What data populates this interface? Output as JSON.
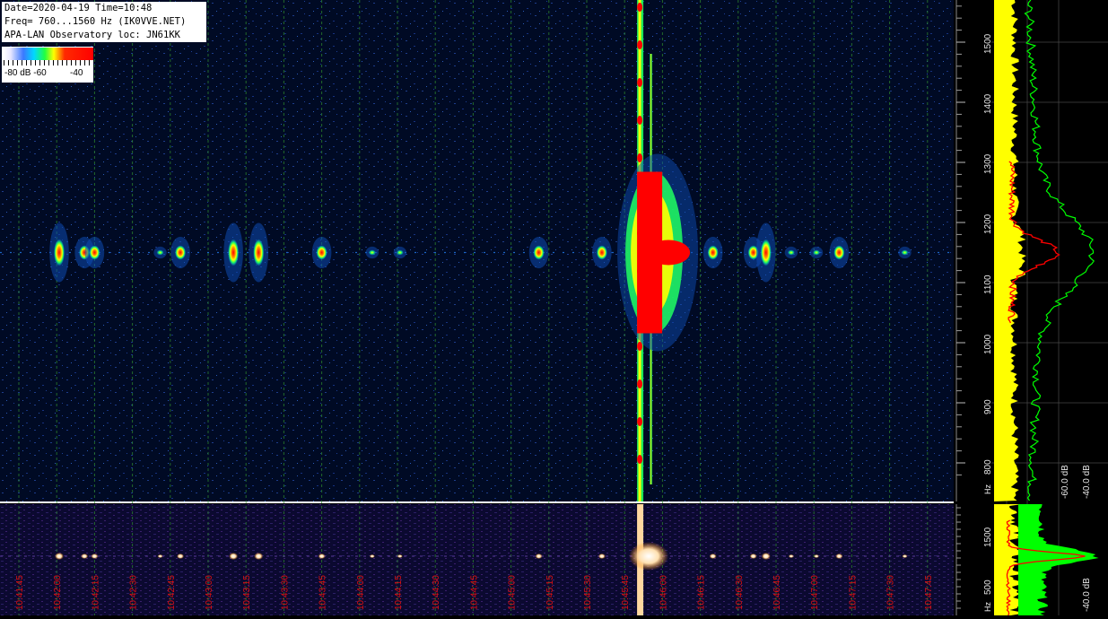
{
  "info": {
    "line1": "Date=2020-04-19 Time=10:48",
    "line2": "Freq= 760...1560 Hz (IK0VVE.NET)",
    "line3": "APA-LAN Observatory loc: JN61KK"
  },
  "colorbar": {
    "label_left": "-80 dB -60",
    "label_right": "-40",
    "colors": [
      "#ffffff",
      "#3a78ff",
      "#00d8ff",
      "#21ff40",
      "#ffff00",
      "#ff2a00",
      "#ff0000"
    ]
  },
  "chart_data": [
    {
      "type": "heatmap",
      "panel": "main-waterfall",
      "x_time_ticks": [
        "10:41:45",
        "10:42:00",
        "10:42:15",
        "10:42:30",
        "10:42:45",
        "10:43:00",
        "10:43:15",
        "10:43:30",
        "10:43:45",
        "10:44:00",
        "10:44:15",
        "10:44:30",
        "10:44:45",
        "10:45:00",
        "10:45:15",
        "10:45:30",
        "10:45:45",
        "10:46:00",
        "10:46:15",
        "10:46:30",
        "10:46:45",
        "10:47:00",
        "10:47:15",
        "10:47:30",
        "10:47:45"
      ],
      "y_freq_ticks": [
        1500,
        1400,
        1300,
        1200,
        1100,
        1000,
        900,
        800
      ],
      "y_unit": "Hz",
      "ylim": [
        760,
        1560
      ],
      "carrier_hz": 1150,
      "events": [
        {
          "time": "10:42:01",
          "strength": "strong"
        },
        {
          "time": "10:42:11",
          "strength": "medium"
        },
        {
          "time": "10:42:15",
          "strength": "medium"
        },
        {
          "time": "10:42:41",
          "strength": "weak"
        },
        {
          "time": "10:42:49",
          "strength": "medium"
        },
        {
          "time": "10:43:10",
          "strength": "strong"
        },
        {
          "time": "10:43:20",
          "strength": "strong"
        },
        {
          "time": "10:43:45",
          "strength": "medium"
        },
        {
          "time": "10:44:05",
          "strength": "weak"
        },
        {
          "time": "10:44:16",
          "strength": "weak"
        },
        {
          "time": "10:45:11",
          "strength": "medium"
        },
        {
          "time": "10:45:36",
          "strength": "medium"
        },
        {
          "time": "10:45:51",
          "strength": "very_strong"
        },
        {
          "time": "10:46:20",
          "strength": "medium"
        },
        {
          "time": "10:46:36",
          "strength": "medium"
        },
        {
          "time": "10:46:41",
          "strength": "strong"
        },
        {
          "time": "10:46:51",
          "strength": "weak"
        },
        {
          "time": "10:47:01",
          "strength": "weak"
        },
        {
          "time": "10:47:10",
          "strength": "medium"
        },
        {
          "time": "10:47:36",
          "strength": "weak"
        }
      ]
    },
    {
      "type": "heatmap",
      "panel": "lower-waterfall",
      "y_freq_ticks": [
        1500,
        500
      ],
      "y_unit": "Hz"
    },
    {
      "type": "line",
      "panel": "main-spectrum",
      "x_db_ticks": [
        "-60.0 dB",
        "-40.0 dB"
      ],
      "series_colors": [
        "#ffff00",
        "#ff0000",
        "#00ff00"
      ],
      "peak_hz": 1150
    },
    {
      "type": "line",
      "panel": "lower-spectrum",
      "x_db_ticks": [
        "-40.0 dB"
      ]
    }
  ],
  "labels": {
    "hz": "Hz"
  }
}
